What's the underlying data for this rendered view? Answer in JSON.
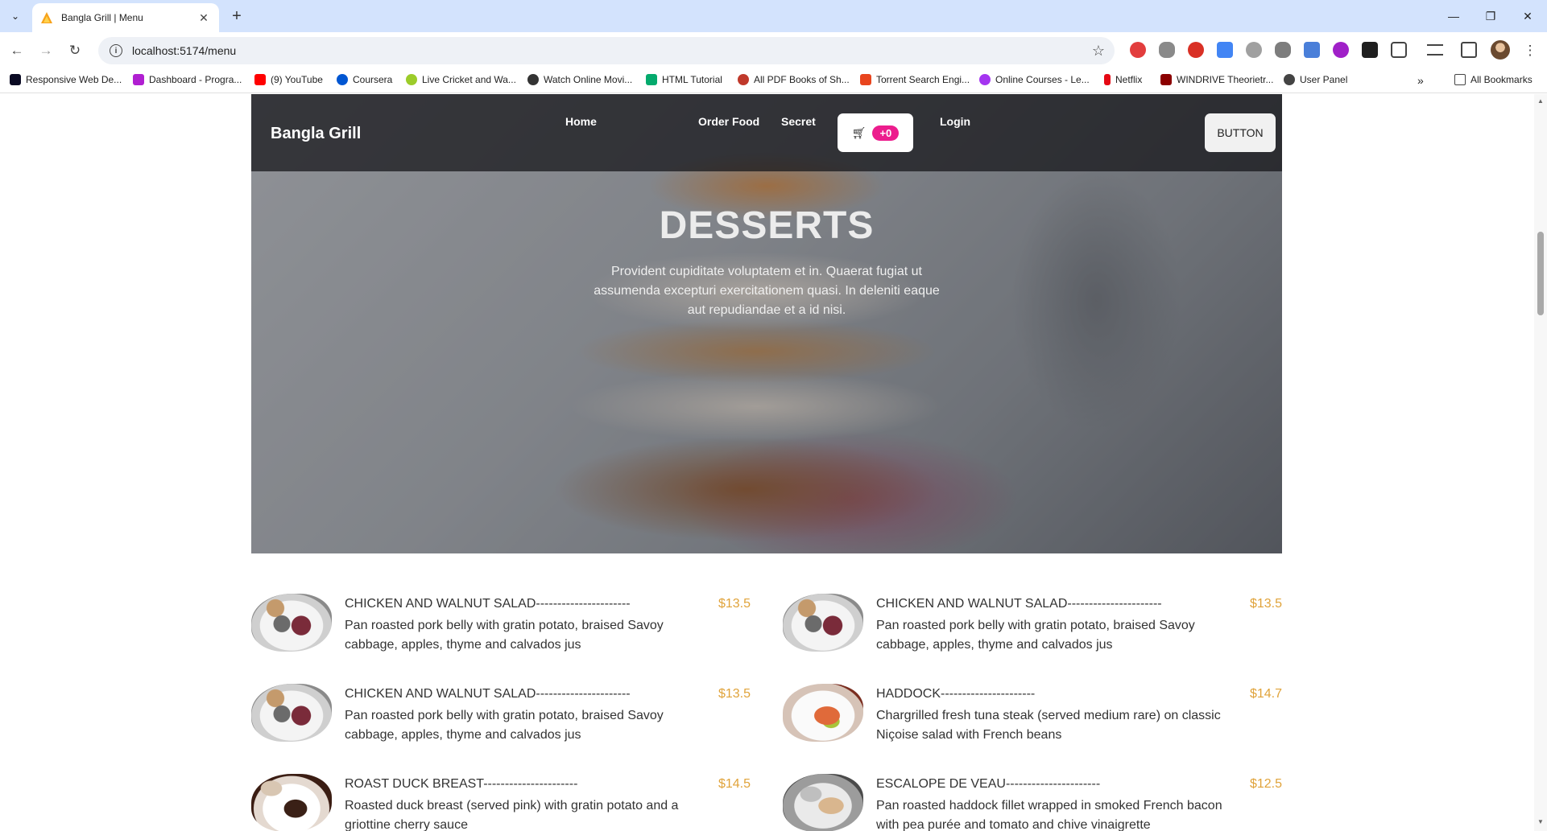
{
  "browser": {
    "tab_title": "Bangla Grill | Menu",
    "url": "localhost:5174/menu",
    "bookmarks": [
      {
        "label": "Responsive Web De...",
        "icon": "freecodecamp-icon",
        "color": "#0a0a23"
      },
      {
        "label": "Dashboard - Progra...",
        "icon": "programming-hero-icon",
        "color": "#b01fd1"
      },
      {
        "label": "(9) YouTube",
        "icon": "youtube-icon",
        "color": "#ff0000"
      },
      {
        "label": "Coursera",
        "icon": "coursera-icon",
        "color": "#0056d2"
      },
      {
        "label": "Live Cricket and Wa...",
        "icon": "cricket-ball-icon",
        "color": "#9ccc2a"
      },
      {
        "label": "Watch Online Movi...",
        "icon": "film-reel-icon",
        "color": "#333333"
      },
      {
        "label": "HTML Tutorial",
        "icon": "w3schools-icon",
        "color": "#04aa6d"
      },
      {
        "label": "All PDF Books of Sh...",
        "icon": "globe-icon",
        "color": "#c0392b"
      },
      {
        "label": "Torrent Search Engi...",
        "icon": "x-icon",
        "color": "#e8451e"
      },
      {
        "label": "Online Courses - Le...",
        "icon": "udemy-icon",
        "color": "#a435f0"
      },
      {
        "label": "Netflix",
        "icon": "netflix-icon",
        "color": "#e50914"
      },
      {
        "label": "WINDRIVE Theorietr...",
        "icon": "windrive-icon",
        "color": "#8b0000"
      },
      {
        "label": "User Panel",
        "icon": "globe-icon",
        "color": "#444444"
      }
    ],
    "all_bookmarks_label": "All Bookmarks"
  },
  "navbar": {
    "brand": "Bangla Grill",
    "links": [
      "Home",
      "Order Food",
      "Secret",
      "Login"
    ],
    "cart_badge": "+0",
    "button_label": "BUTTON"
  },
  "hero": {
    "title": "DESSERTS",
    "description": "Provident cupiditate voluptatem et in. Quaerat fugiat ut assumenda excepturi exercitationem quasi. In deleniti eaque aut repudiandae et a id nisi."
  },
  "menu_items": [
    {
      "name": "CHICKEN AND WALNUT SALAD----------------------",
      "price": "$13.5",
      "description": "Pan roasted pork belly with gratin potato, braised Savoy cabbage, apples, thyme and calvados jus",
      "image": "salad"
    },
    {
      "name": "CHICKEN AND WALNUT SALAD----------------------",
      "price": "$13.5",
      "description": "Pan roasted pork belly with gratin potato, braised Savoy cabbage, apples, thyme and calvados jus",
      "image": "salad"
    },
    {
      "name": "CHICKEN AND WALNUT SALAD----------------------",
      "price": "$13.5",
      "description": "Pan roasted pork belly with gratin potato, braised Savoy cabbage, apples, thyme and calvados jus",
      "image": "salad"
    },
    {
      "name": "HADDOCK----------------------",
      "price": "$14.7",
      "description": "Chargrilled fresh tuna steak (served medium rare) on classic Niçoise salad with French beans",
      "image": "haddock"
    },
    {
      "name": "ROAST DUCK BREAST----------------------",
      "price": "$14.5",
      "description": "Roasted duck breast (served pink) with gratin potato and a griottine cherry sauce",
      "image": "duck"
    },
    {
      "name": "ESCALOPE DE VEAU----------------------",
      "price": "$12.5",
      "description": "Pan roasted haddock fillet wrapped in smoked French bacon with pea purée and tomato and chive vinaigrette",
      "image": "veau"
    }
  ],
  "colors": {
    "accent_price": "#e0a33a",
    "cart_badge": "#ec1d8d",
    "tabstrip": "#d3e3fd"
  }
}
